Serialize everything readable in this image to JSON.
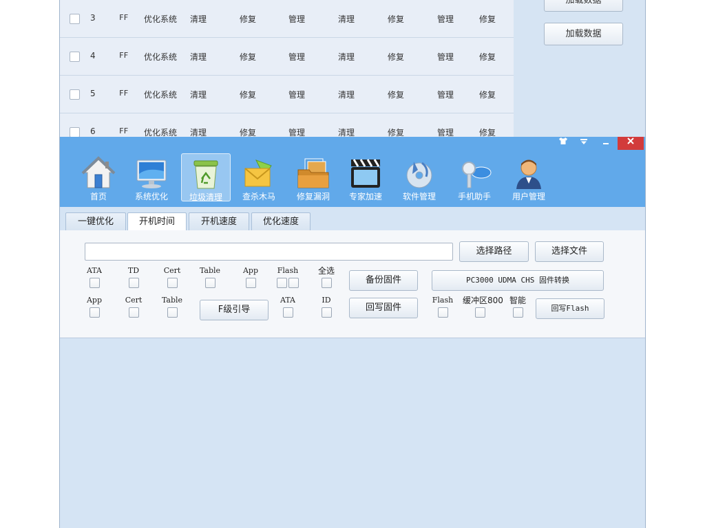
{
  "background": {
    "rows": [
      {
        "num": "3",
        "c1": "FF",
        "c2": "优化系统",
        "c3": "清理",
        "c4": "修复",
        "c5": "管理",
        "c6": "清理",
        "c7": "修复",
        "c8": "管理",
        "c9": "修复"
      },
      {
        "num": "4",
        "c1": "FF",
        "c2": "优化系统",
        "c3": "清理",
        "c4": "修复",
        "c5": "管理",
        "c6": "清理",
        "c7": "修复",
        "c8": "管理",
        "c9": "修复"
      },
      {
        "num": "5",
        "c1": "FF",
        "c2": "优化系统",
        "c3": "清理",
        "c4": "修复",
        "c5": "管理",
        "c6": "清理",
        "c7": "修复",
        "c8": "管理",
        "c9": "修复"
      },
      {
        "num": "6",
        "c1": "FF",
        "c2": "优化系统",
        "c3": "清理",
        "c4": "修复",
        "c5": "管理",
        "c6": "清理",
        "c7": "修复",
        "c8": "管理",
        "c9": "修复"
      }
    ],
    "load_button_top": "加载数据",
    "load_button": "加载数据"
  },
  "window": {
    "controls": {
      "skin": "skin-icon",
      "menu": "menu-icon",
      "minimize": "–",
      "close": "✕"
    },
    "nav": [
      {
        "label": "首页",
        "icon": "home-icon"
      },
      {
        "label": "系统优化",
        "icon": "monitor-icon"
      },
      {
        "label": "垃圾清理",
        "icon": "recycle-bin-icon",
        "active": true
      },
      {
        "label": "查杀木马",
        "icon": "mail-icon"
      },
      {
        "label": "修复漏洞",
        "icon": "folder-photo-icon"
      },
      {
        "label": "专家加速",
        "icon": "clapper-icon"
      },
      {
        "label": "软件管理",
        "icon": "disc-icon"
      },
      {
        "label": "手机助手",
        "icon": "key-icon"
      },
      {
        "label": "用户管理",
        "icon": "user-icon"
      }
    ],
    "tabs": [
      {
        "label": "一键优化"
      },
      {
        "label": "开机时间",
        "active": true
      },
      {
        "label": "开机速度"
      },
      {
        "label": "优化速度"
      }
    ],
    "path_input": {
      "value": "",
      "placeholder": ""
    },
    "buttons": {
      "select_path": "选择路径",
      "select_file": "选择文件",
      "backup_firmware": "备份固件",
      "pc3000": "PC3000 UDMA CHS  固件转换",
      "f_boot": "F级引导",
      "write_back_firmware": "回写固件",
      "write_back_flash": "回写Flash"
    },
    "row1_opts": [
      "ATA",
      "TD",
      "Cert",
      "Table",
      "App",
      "Flash",
      "全选"
    ],
    "row2_opts": [
      "App",
      "Cert",
      "Table"
    ],
    "row2_mid_opts": [
      "ATA",
      "ID"
    ],
    "row2_right_opts": [
      "Flash",
      "缓冲区800",
      "智能"
    ]
  }
}
